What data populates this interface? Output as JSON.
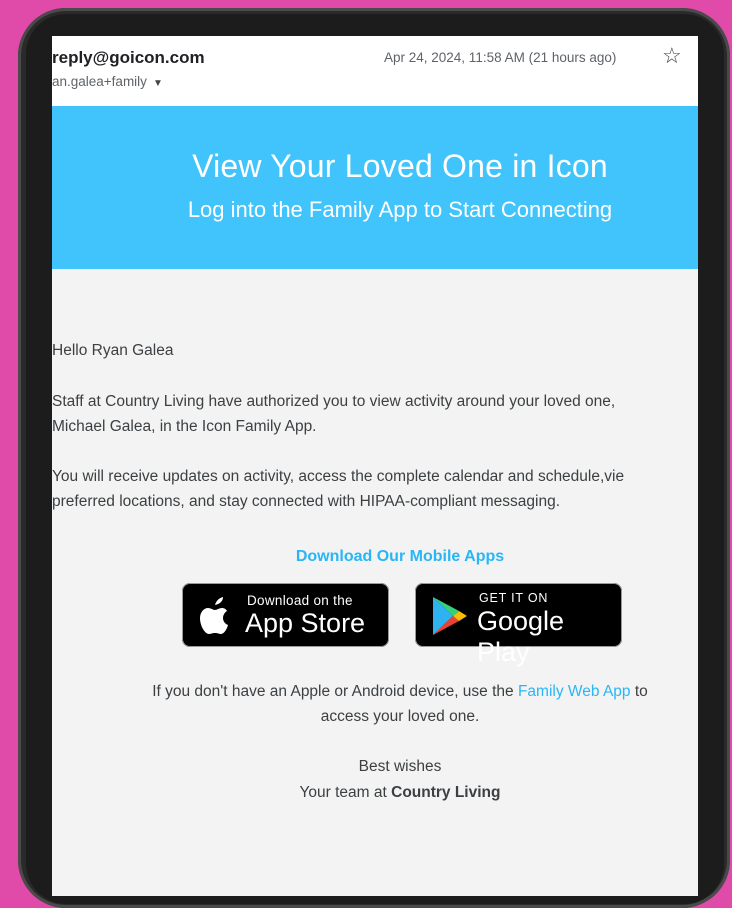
{
  "email": {
    "sender": "reply@goicon.com",
    "recipient": "an.galea+family",
    "date": "Apr 24, 2024, 11:58 AM (21 hours ago)",
    "star_icon": "star-outline-icon"
  },
  "banner": {
    "title": "View Your Loved One in Icon",
    "subtitle": "Log into the Family App to Start Connecting",
    "color": "#40c4fb"
  },
  "body": {
    "greeting": "Hello Ryan Galea",
    "p1_line1": "Staff at Country Living have authorized you to view activity around your loved one,",
    "p1_line2": "Michael Galea, in the Icon Family App.",
    "p2_line1": "You will receive updates on activity, access the complete calendar and schedule,vie",
    "p2_line2": "preferred locations, and stay connected with HIPAA-compliant messaging."
  },
  "download": {
    "title": "Download Our Mobile Apps",
    "apple_small": "Download on the",
    "apple_big": "App Store",
    "google_small": "GET IT ON",
    "google_big": "Google Play"
  },
  "footer": {
    "line1_pre": "If you don't have an Apple or Android device, use the ",
    "link": "Family Web App",
    "line1_post": " to",
    "line2": "access your loved one.",
    "sign1": "Best wishes",
    "sign2_pre": "Your team at ",
    "sign2_bold": "Country Living"
  },
  "colors": {
    "background": "#e04aa8",
    "link": "#29b6f6"
  }
}
